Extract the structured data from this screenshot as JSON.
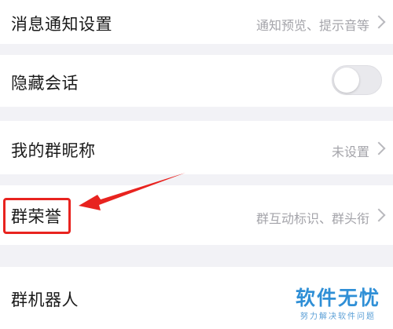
{
  "settings": {
    "rows": [
      {
        "label": "消息通知设置",
        "value": "通知预览、提示音等"
      },
      {
        "label": "隐藏会话",
        "toggle_on": false
      },
      {
        "label": "我的群昵称",
        "value": "未设置"
      },
      {
        "label": "群荣誉",
        "value": "群互动标识、群头衔"
      },
      {
        "label": "群机器人"
      }
    ]
  },
  "annotation": {
    "highlight_color": "#e8231f"
  },
  "watermark": {
    "main": "软件无忧",
    "sub": "努力解决软件问题"
  }
}
